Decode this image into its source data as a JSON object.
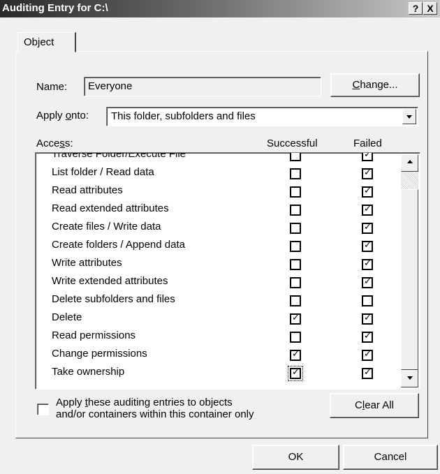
{
  "window": {
    "title": "Auditing Entry for C:\\",
    "help_glyph": "?",
    "close_glyph": "X"
  },
  "tab": {
    "label": "Object"
  },
  "name_field": {
    "label": "Name:",
    "value": "Everyone"
  },
  "change_button": {
    "label": "Change...",
    "mnemonic": "C",
    "rest": "hange..."
  },
  "apply_onto": {
    "label_pre": "Apply ",
    "label_mn": "o",
    "label_post": "nto:",
    "value": "This folder, subfolders and files"
  },
  "access_list": {
    "header_pre": "Acce",
    "header_mn": "s",
    "header_post": "s:",
    "col_successful": "Successful",
    "col_failed": "Failed",
    "rows": [
      {
        "label": "Traverse Folder/Execute File",
        "successful": false,
        "failed": true
      },
      {
        "label": "List folder / Read data",
        "successful": false,
        "failed": true
      },
      {
        "label": "Read attributes",
        "successful": false,
        "failed": true
      },
      {
        "label": "Read extended attributes",
        "successful": false,
        "failed": true
      },
      {
        "label": "Create files / Write data",
        "successful": false,
        "failed": true
      },
      {
        "label": "Create folders / Append data",
        "successful": false,
        "failed": true
      },
      {
        "label": "Write attributes",
        "successful": false,
        "failed": true
      },
      {
        "label": "Write extended attributes",
        "successful": false,
        "failed": true
      },
      {
        "label": "Delete subfolders and files",
        "successful": false,
        "failed": false
      },
      {
        "label": "Delete",
        "successful": true,
        "failed": true
      },
      {
        "label": "Read permissions",
        "successful": false,
        "failed": true
      },
      {
        "label": "Change permissions",
        "successful": true,
        "failed": true
      },
      {
        "label": "Take ownership",
        "successful": true,
        "failed": true
      }
    ]
  },
  "apply_only": {
    "line1_pre": "Apply ",
    "line1_mn": "t",
    "line1_post": "hese auditing entries to objects",
    "line2": "and/or containers within this container only",
    "checked": false
  },
  "clear_all_button": {
    "pre": "C",
    "mn": "l",
    "post": "ear All"
  },
  "ok_button": {
    "label": "OK"
  },
  "cancel_button": {
    "label": "Cancel"
  },
  "check_glyph": "✓",
  "colors": {
    "titlebar_start": "#2a2a2a",
    "titlebar_end": "#c8c8c8",
    "face": "#f0f0f0"
  }
}
